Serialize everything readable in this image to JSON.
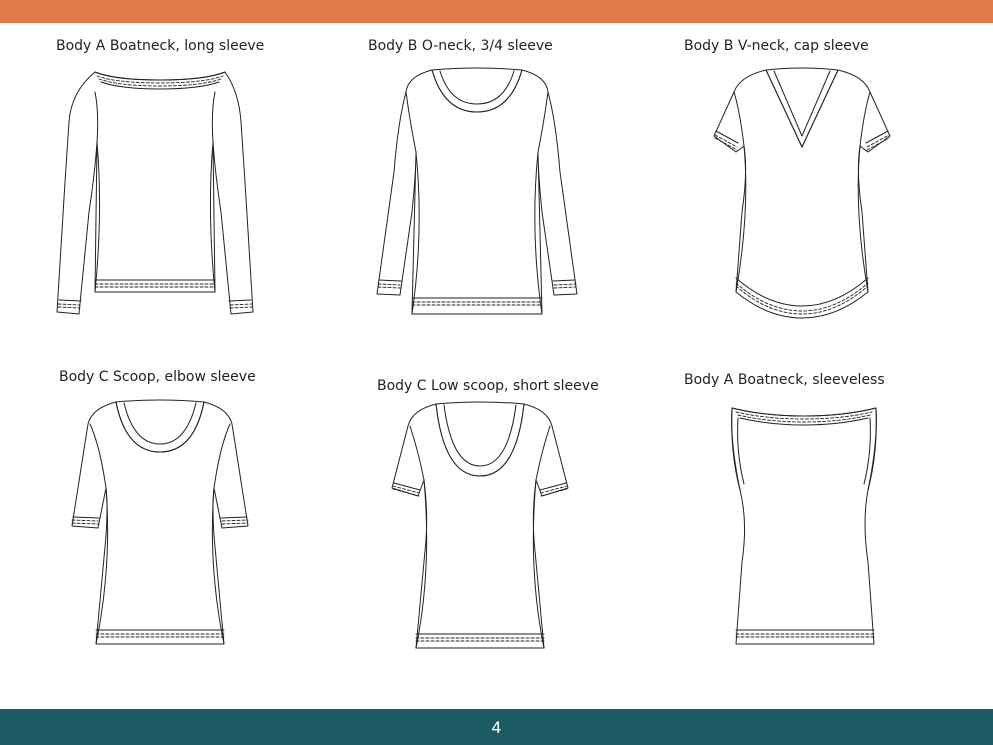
{
  "header": {
    "accent_color": "#e07a4b"
  },
  "footer": {
    "color": "#1c5a64",
    "page_number": "4"
  },
  "garments": [
    {
      "label": "Body A Boatneck, long sleeve",
      "icon": "long-sleeve-boatneck-top-icon"
    },
    {
      "label": "Body B O-neck, 3/4 sleeve",
      "icon": "three-quarter-sleeve-oneck-top-icon"
    },
    {
      "label": "Body B  V-neck, cap sleeve",
      "icon": "cap-sleeve-vneck-top-icon"
    },
    {
      "label": "Body C Scoop, elbow sleeve",
      "icon": "elbow-sleeve-scoop-top-icon"
    },
    {
      "label": "Body C Low scoop, short sleeve",
      "icon": "short-sleeve-low-scoop-top-icon"
    },
    {
      "label": "Body A Boatneck, sleeveless",
      "icon": "sleeveless-boatneck-top-icon"
    }
  ]
}
